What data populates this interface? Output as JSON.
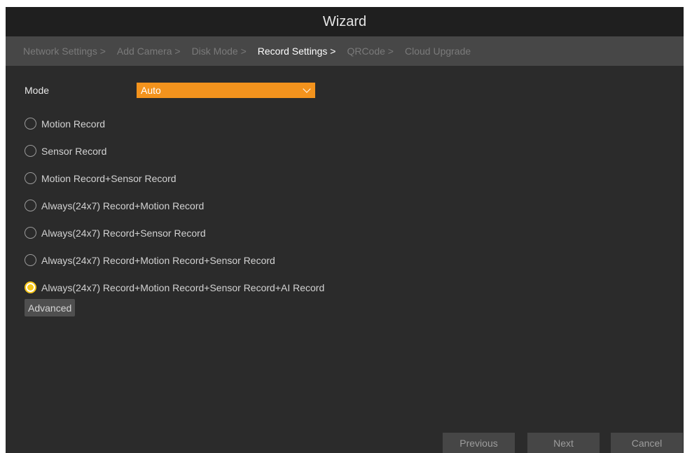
{
  "window": {
    "title": "Wizard"
  },
  "steps": [
    {
      "label": "Network Settings >",
      "active": false
    },
    {
      "label": "Add Camera >",
      "active": false
    },
    {
      "label": "Disk Mode >",
      "active": false
    },
    {
      "label": "Record Settings >",
      "active": true
    },
    {
      "label": "QRCode >",
      "active": false
    },
    {
      "label": "Cloud Upgrade",
      "active": false
    }
  ],
  "mode": {
    "label": "Mode",
    "value": "Auto",
    "accent": "#f3931d"
  },
  "options": [
    {
      "label": "Motion Record",
      "checked": false
    },
    {
      "label": "Sensor Record",
      "checked": false
    },
    {
      "label": "Motion Record+Sensor Record",
      "checked": false
    },
    {
      "label": "Always(24x7) Record+Motion Record",
      "checked": false
    },
    {
      "label": "Always(24x7) Record+Sensor Record",
      "checked": false
    },
    {
      "label": "Always(24x7) Record+Motion Record+Sensor Record",
      "checked": false
    },
    {
      "label": "Always(24x7) Record+Motion Record+Sensor Record+AI Record",
      "checked": true
    }
  ],
  "advanced_label": "Advanced",
  "footer": {
    "previous": "Previous",
    "next": "Next",
    "cancel": "Cancel"
  }
}
